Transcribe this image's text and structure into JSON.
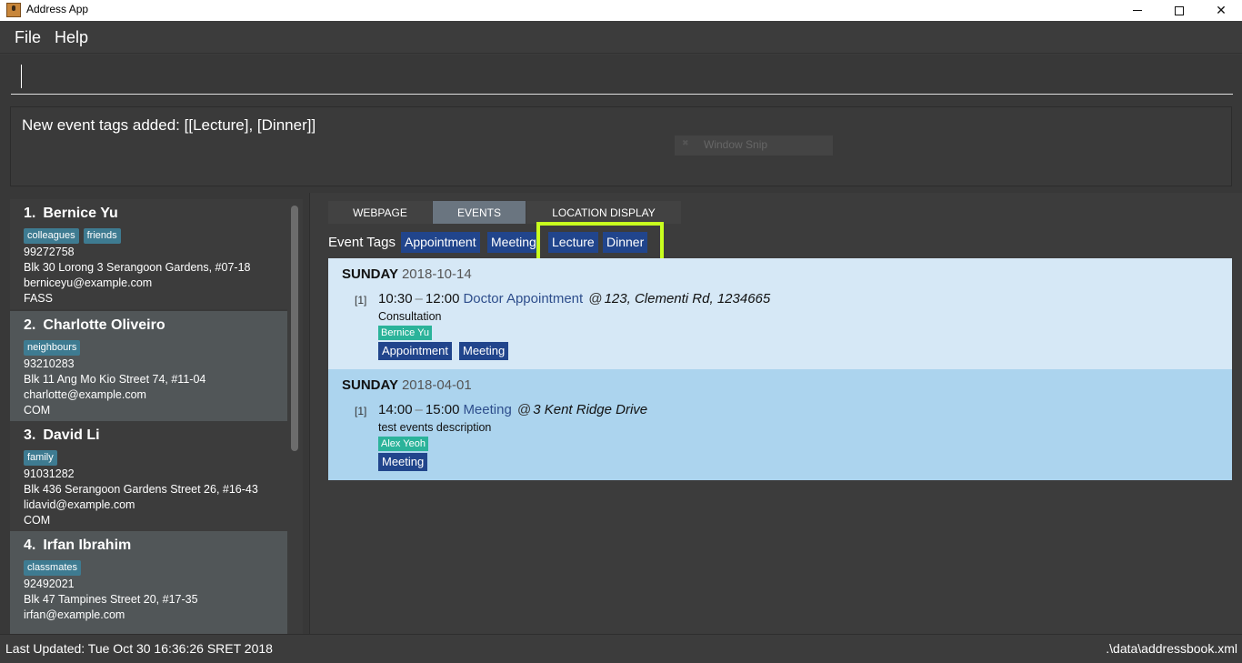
{
  "window": {
    "title": "Address App",
    "minimize": "—",
    "maximize": "☐",
    "close": "✕"
  },
  "menu": {
    "file": "File",
    "help": "Help"
  },
  "command": {
    "value": "",
    "placeholder": ""
  },
  "result": {
    "text": "New event tags added: [[Lecture], [Dinner]]",
    "overlay": "Window Snip"
  },
  "persons": [
    {
      "index": "1.",
      "name": "Bernice Yu",
      "tags": [
        "colleagues",
        "friends"
      ],
      "phone": "99272758",
      "address": "Blk 30 Lorong 3 Serangoon Gardens, #07-18",
      "email": "berniceyu@example.com",
      "faculty": "FASS"
    },
    {
      "index": "2.",
      "name": "Charlotte Oliveiro",
      "tags": [
        "neighbours"
      ],
      "phone": "93210283",
      "address": "Blk 11 Ang Mo Kio Street 74, #11-04",
      "email": "charlotte@example.com",
      "faculty": "COM"
    },
    {
      "index": "3.",
      "name": "David Li",
      "tags": [
        "family"
      ],
      "phone": "91031282",
      "address": "Blk 436 Serangoon Gardens Street 26, #16-43",
      "email": "lidavid@example.com",
      "faculty": "COM"
    },
    {
      "index": "4.",
      "name": "Irfan Ibrahim",
      "tags": [
        "classmates"
      ],
      "phone": "92492021",
      "address": "Blk 47 Tampines Street 20, #17-35",
      "email": "irfan@example.com",
      "faculty": ""
    }
  ],
  "tabs": {
    "webpage": "WEBPAGE",
    "events": "EVENTS",
    "location": "LOCATION DISPLAY"
  },
  "event_tags": {
    "label": "Event Tags",
    "items": [
      "Appointment",
      "Meeting",
      "Lecture",
      "Dinner"
    ]
  },
  "events": [
    {
      "day": "SUNDAY",
      "date": "2018-10-14",
      "num": "[1]",
      "start": "10:30",
      "dash": "–",
      "end": "12:00",
      "name": "Doctor Appointment",
      "at": "@",
      "location": "123, Clementi Rd, 1234665",
      "description": "Consultation",
      "person": "Bernice Yu",
      "tags": [
        "Appointment",
        "Meeting"
      ]
    },
    {
      "day": "SUNDAY",
      "date": "2018-04-01",
      "num": "[1]",
      "start": "14:00",
      "dash": "–",
      "end": "15:00",
      "name": "Meeting",
      "at": "@",
      "location": "3 Kent Ridge Drive",
      "description": "test events description",
      "person": "Alex Yeoh",
      "tags": [
        "Meeting"
      ]
    }
  ],
  "status": {
    "last_updated": "Last Updated: Tue Oct 30 16:36:26 SRET 2018",
    "path": ".\\data\\addressbook.xml"
  },
  "colors": {
    "tag_teal": "#3e7b91",
    "event_tag_blue": "#21458c",
    "person_green": "#2bb39a",
    "highlight": "#c8ff1e"
  }
}
